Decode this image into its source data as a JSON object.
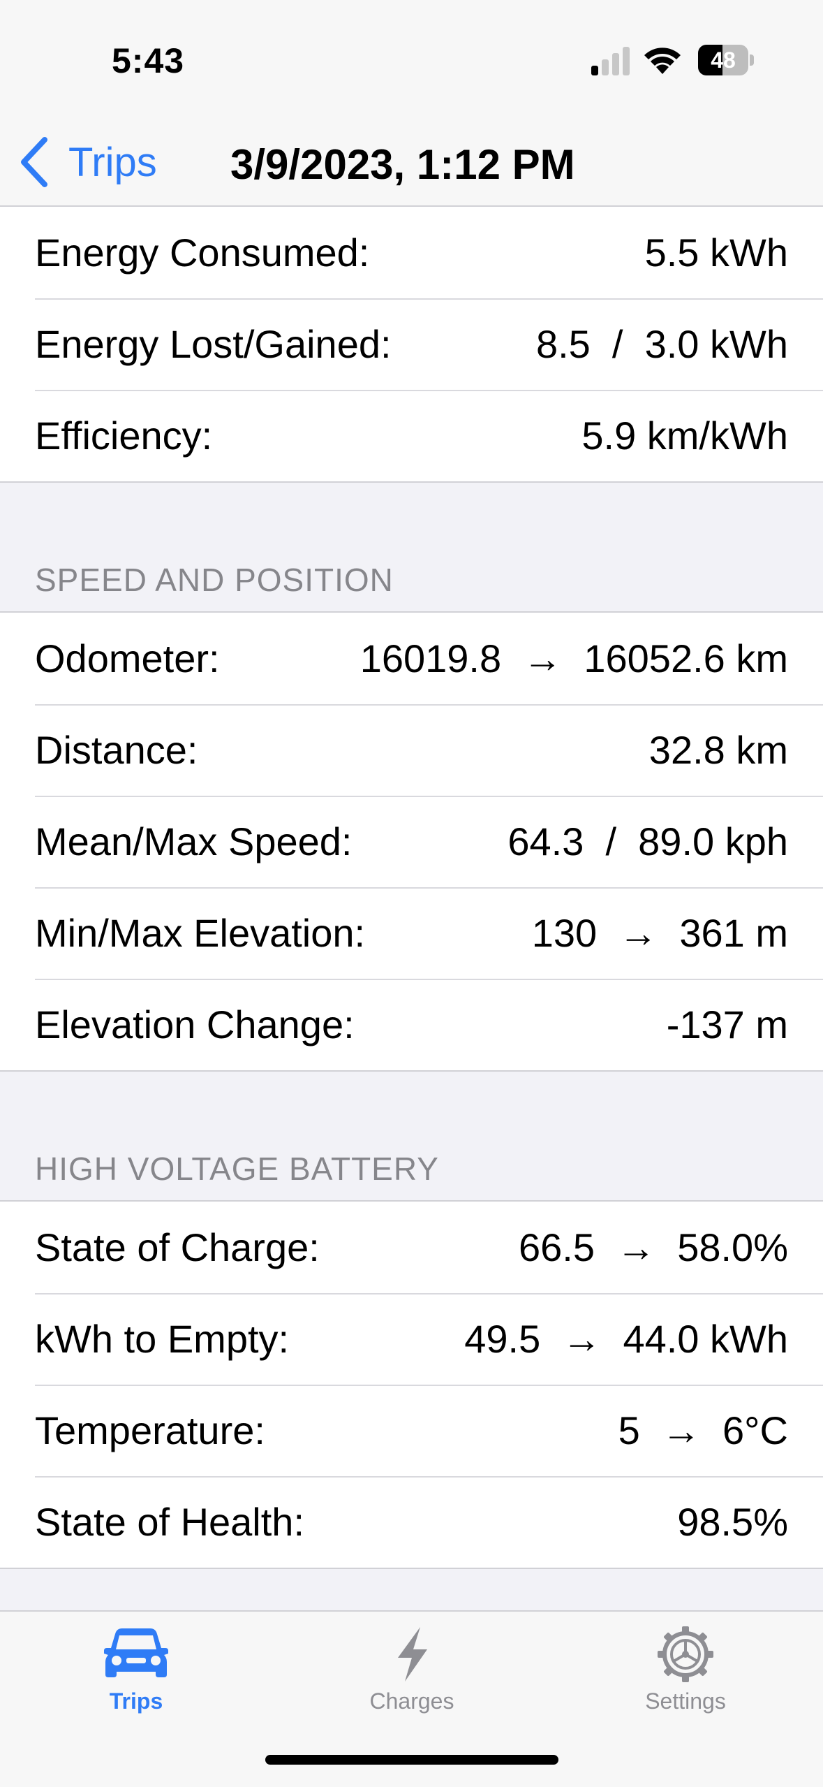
{
  "status": {
    "time": "5:43",
    "battery": "48",
    "battery_level": 0.48
  },
  "nav": {
    "back_label": "Trips",
    "title": "3/9/2023, 1:12 PM"
  },
  "groups": {
    "energy": [
      {
        "label": "Energy Consumed:",
        "value": "5.5 kWh"
      },
      {
        "label": "Energy Lost/Gained:",
        "value": "8.5  /  3.0 kWh"
      },
      {
        "label": "Efficiency:",
        "value": "5.9 km/kWh"
      }
    ],
    "speed": [
      {
        "label": "Odometer:",
        "value": "16019.8  →  16052.6 km"
      },
      {
        "label": "Distance:",
        "value": "32.8 km"
      },
      {
        "label": "Mean/Max Speed:",
        "value": "64.3  /  89.0 kph"
      },
      {
        "label": "Min/Max Elevation:",
        "value": "130  →  361 m"
      },
      {
        "label": "Elevation Change:",
        "value": "-137 m"
      }
    ],
    "battery": [
      {
        "label": "State of Charge:",
        "value": "66.5  →  58.0%"
      },
      {
        "label": "kWh to Empty:",
        "value": "49.5  →  44.0 kWh"
      },
      {
        "label": "Temperature:",
        "value": "5  →  6°C"
      },
      {
        "label": "State of Health:",
        "value": "98.5%"
      }
    ]
  },
  "sections": {
    "speed_header": "SPEED AND POSITION",
    "battery_header": "HIGH VOLTAGE BATTERY"
  },
  "tabs": [
    {
      "label": "Trips",
      "icon": "car-icon"
    },
    {
      "label": "Charges",
      "icon": "bolt-icon"
    },
    {
      "label": "Settings",
      "icon": "gear-icon"
    }
  ],
  "colors": {
    "accent": "#2f7cf6",
    "inactive": "#8e8e93"
  }
}
